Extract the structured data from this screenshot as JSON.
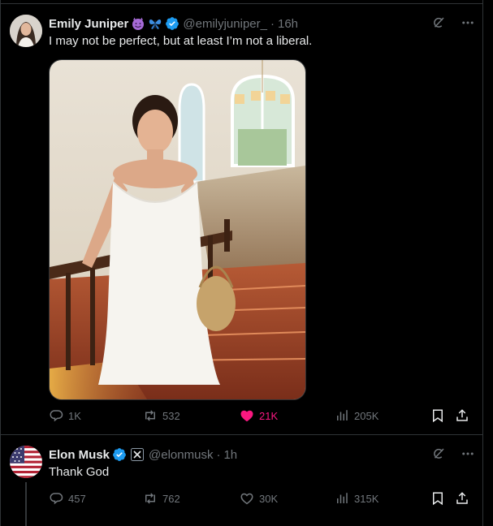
{
  "post1": {
    "author_name": "Emily Juniper",
    "handle": "@emilyjuniper_",
    "time": "16h",
    "text": "I may not be perfect, but at least I’m not a liberal.",
    "metrics": {
      "replies": "1K",
      "reposts": "532",
      "likes": "21K",
      "views": "205K"
    },
    "liked": true,
    "colors": {
      "like_active": "#f91880",
      "verified": "#1d9bf0"
    },
    "emojis": [
      "smiling-devil-emoji",
      "butterfly-emoji"
    ]
  },
  "post2": {
    "author_name": "Elon Musk",
    "handle": "@elonmusk",
    "time": "1h",
    "text": "Thank God",
    "metrics": {
      "replies": "457",
      "reposts": "762",
      "likes": "30K",
      "views": "315K"
    }
  },
  "theme": {
    "background": "#000000",
    "text": "#e7e9ea",
    "muted": "#71767b",
    "border": "#2f3336"
  }
}
